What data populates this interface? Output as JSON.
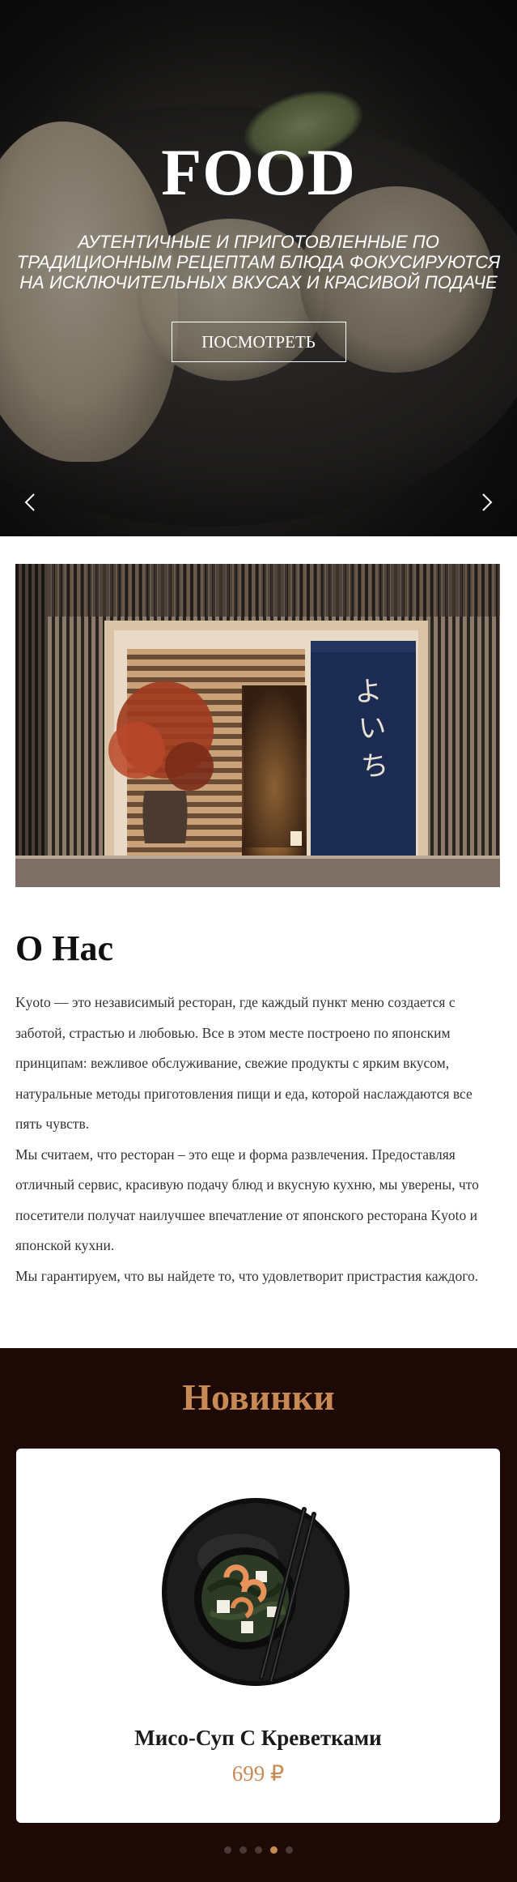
{
  "hero": {
    "title": "FOOD",
    "subtitle": "АУТЕНТИЧНЫЕ И ПРИГОТОВЛЕННЫЕ ПО ТРАДИЦИОННЫМ РЕЦЕПТАМ БЛЮДА ФОКУСИРУЮТСЯ НА ИСКЛЮЧИТЕЛЬНЫХ ВКУСАХ И КРАСИВОЙ ПОДАЧЕ",
    "button_label": "ПОСМОТРЕТЬ",
    "prev_icon": "chevron-left-icon",
    "next_icon": "chevron-right-icon"
  },
  "about": {
    "title": "О Нас",
    "paragraphs": [
      "Kyoto — это независимый ресторан, где каждый пункт меню создается с заботой, страстью и любовью. Все в этом месте построено по японским принципам: вежливое обслуживание, свежие продукты с ярким вкусом, натуральные методы приготовления пищи и еда, которой наслаждаются все пять чувств.",
      "Мы считаем, что ресторан – это еще и форма развлечения. Предоставляя отличный сервис, красивую подачу блюд и вкусную кухню, мы уверены, что посетители получат наилучшее впечатление от японского ресторана Kyoto и японской кухни.",
      "Мы гарантируем, что вы найдете то, что удовлетворит пристрастия каждого."
    ]
  },
  "news": {
    "title": "Новинки",
    "item": {
      "name": "Мисо-Суп С Креветками",
      "price": "699 ₽"
    },
    "slides_total": 5,
    "active_slide": 4
  },
  "colors": {
    "accent": "#c88a55",
    "news_bg": "#1d0a06"
  }
}
